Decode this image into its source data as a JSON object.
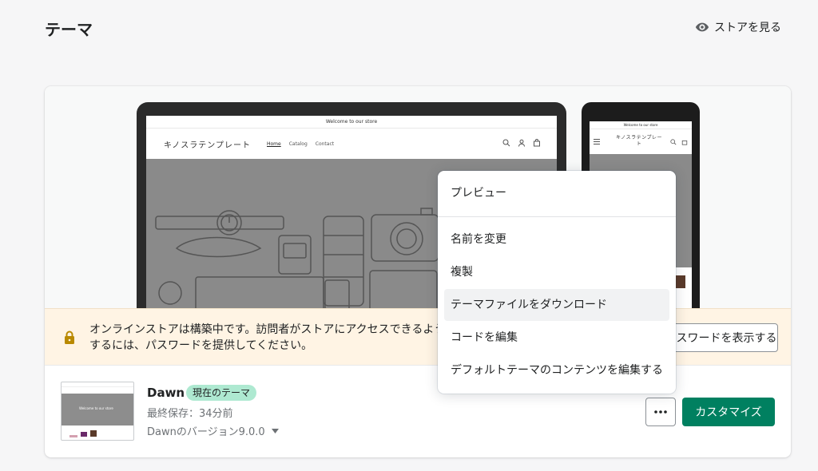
{
  "page": {
    "title": "テーマ",
    "view_store": "ストアを見る"
  },
  "preview": {
    "desktop": {
      "announcement": "Welcome to our store",
      "store_name": "キノスラテンプレート",
      "nav": [
        "Home",
        "Catalog",
        "Contact"
      ]
    },
    "mobile": {
      "announcement": "Welcome to our store",
      "store_name": "キノスラテンプレート"
    }
  },
  "banner": {
    "text": "オンラインストアは構築中です。訪問者がストアにアクセスできるようにするには、パスワードを提供してください。",
    "button_label": "パスワードを表示する"
  },
  "theme": {
    "name": "Dawn",
    "badge": "現在のテーマ",
    "last_saved": "最終保存：34分前",
    "version": "Dawnのバージョン9.0.0",
    "thumb_text": "Welcome to our store"
  },
  "actions": {
    "more_label": "•••",
    "customize_label": "カスタマイズ"
  },
  "menu": {
    "preview": "プレビュー",
    "rename": "名前を変更",
    "duplicate": "複製",
    "download": "テーマファイルをダウンロード",
    "edit_code": "コードを編集",
    "edit_default_content": "デフォルトテーマのコンテンツを編集する"
  },
  "colors": {
    "primary": "#008060",
    "badge": "#aee9d1",
    "banner": "#fff4e4"
  }
}
